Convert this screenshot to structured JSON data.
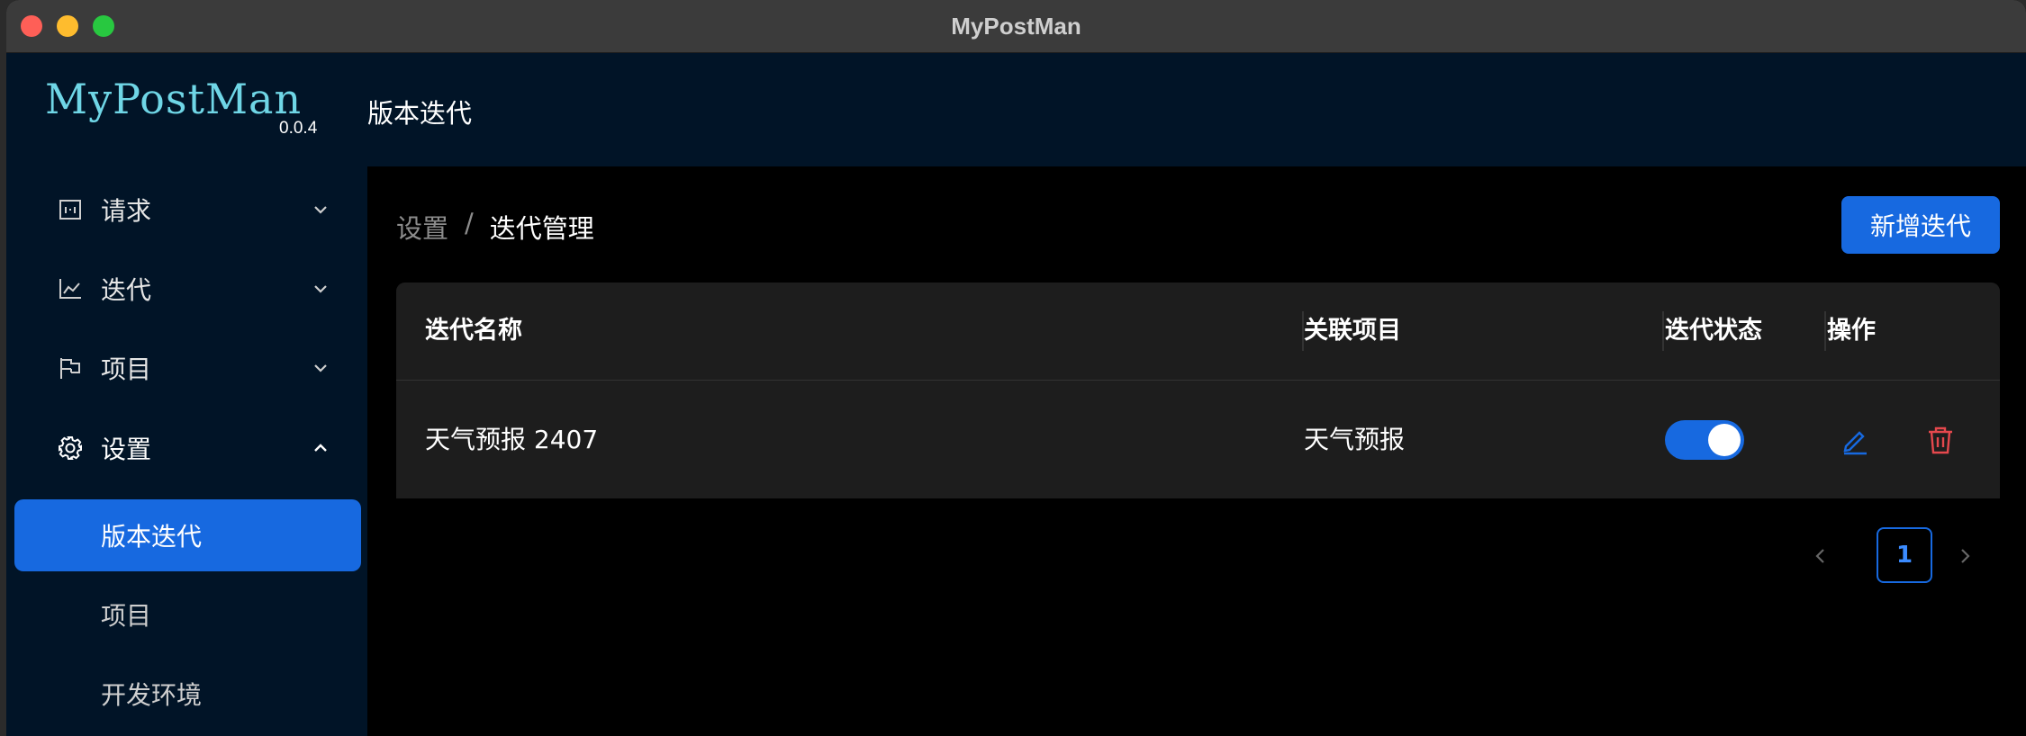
{
  "window": {
    "title": "MyPostMan"
  },
  "header": {
    "logo": "MyPostMan",
    "version": "0.0.4",
    "title": "版本迭代"
  },
  "sidebar": {
    "items": [
      {
        "label": "请求",
        "icon": "request-icon",
        "expanded": false
      },
      {
        "label": "迭代",
        "icon": "chart-icon",
        "expanded": false
      },
      {
        "label": "项目",
        "icon": "flag-icon",
        "expanded": false
      },
      {
        "label": "设置",
        "icon": "gear-icon",
        "expanded": true
      }
    ],
    "subitems": [
      {
        "label": "版本迭代",
        "active": true
      },
      {
        "label": "项目",
        "active": false
      },
      {
        "label": "开发环境",
        "active": false
      }
    ]
  },
  "breadcrumb": {
    "parent": "设置",
    "separator": "/",
    "current": "迭代管理"
  },
  "toolbar": {
    "add_label": "新增迭代"
  },
  "table": {
    "columns": [
      "迭代名称",
      "关联项目",
      "迭代状态",
      "操作"
    ],
    "rows": [
      {
        "name": "天气预报 2407",
        "project": "天气预报",
        "status_on": true
      }
    ]
  },
  "pagination": {
    "current": "1"
  },
  "colors": {
    "accent": "#1769e0",
    "sidebar_bg": "#011427",
    "danger": "#e5484d",
    "logo": "#6fd6e6"
  }
}
